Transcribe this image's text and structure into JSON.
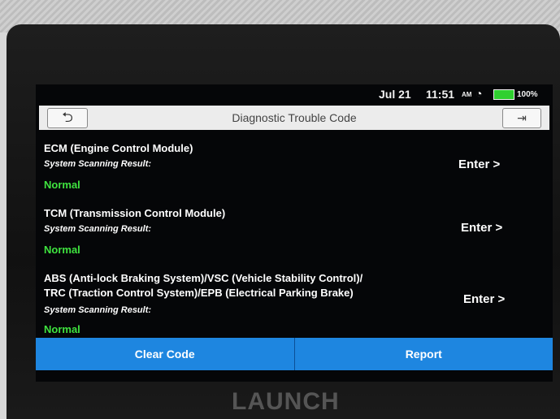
{
  "status_bar": {
    "date": "Jul 21",
    "time": "11:51",
    "ampm": "AM",
    "battery": "100%"
  },
  "header": {
    "title": "Diagnostic Trouble Code"
  },
  "systems": [
    {
      "name_line1": "ECM (Engine Control Module)",
      "result_label": "System Scanning Result:",
      "status": "Normal",
      "action": "Enter >"
    },
    {
      "name_line1": "TCM (Transmission Control Module)",
      "result_label": "System Scanning Result:",
      "status": "Normal",
      "action": "Enter >"
    },
    {
      "name_line1": "ABS (Anti-lock Braking System)/VSC (Vehicle Stability Control)/",
      "name_line2": "TRC (Traction Control System)/EPB (Electrical Parking Brake)",
      "result_label": "System Scanning Result:",
      "status": "Normal",
      "action": "Enter >"
    }
  ],
  "footer": {
    "clear_label": "Clear Code",
    "report_label": "Report"
  },
  "device": {
    "brand": "LAUNCH"
  }
}
